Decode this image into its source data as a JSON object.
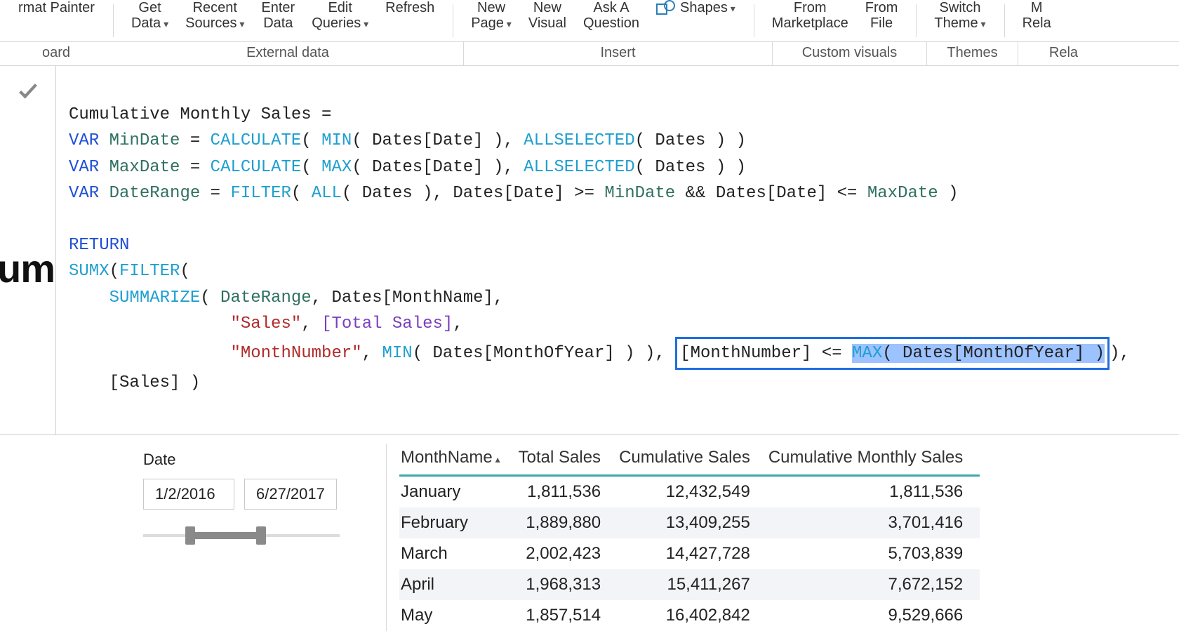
{
  "ribbon": {
    "format_painter_l1": "rmat Painter",
    "get_data_l1": "Get",
    "get_data_l2": "Data",
    "recent_l1": "Recent",
    "recent_l2": "Sources",
    "enter_l1": "Enter",
    "enter_l2": "Data",
    "edit_l1": "Edit",
    "edit_l2": "Queries",
    "refresh": "Refresh",
    "newpage_l1": "New",
    "newpage_l2": "Page",
    "newvis_l1": "New",
    "newvis_l2": "Visual",
    "ask_l1": "Ask A",
    "ask_l2": "Question",
    "shapes": "Shapes",
    "market_l1": "From",
    "market_l2": "Marketplace",
    "file_l1": "From",
    "file_l2": "File",
    "theme_l1": "Switch",
    "theme_l2": "Theme",
    "rel_l1": "M",
    "rel_l2": "Rela",
    "grp_clipboard": "oard",
    "grp_external": "External data",
    "grp_insert": "Insert",
    "grp_custom": "Custom visuals",
    "grp_themes": "Themes",
    "grp_rel": "Rela"
  },
  "leftFragment": "um",
  "formula": {
    "l1_a": "Cumulative Monthly Sales = ",
    "l2_var": "VAR",
    "l2_name": "MinDate",
    "l2_eq": " = ",
    "l2_calc": "CALCULATE",
    "l2_p1": "( ",
    "l2_min": "MIN",
    "l2_p2": "( Dates[Date] ), ",
    "l2_all": "ALLSELECTED",
    "l2_p3": "( Dates ) )",
    "l3_var": "VAR",
    "l3_name": "MaxDate",
    "l3_eq": " = ",
    "l3_calc": "CALCULATE",
    "l3_p1": "( ",
    "l3_max": "MAX",
    "l3_p2": "( Dates[Date] ), ",
    "l3_all": "ALLSELECTED",
    "l3_p3": "( Dates ) )",
    "l4_var": "VAR",
    "l4_name": "DateRange",
    "l4_eq": " = ",
    "l4_filter": "FILTER",
    "l4_p1": "( ",
    "l4_all": "ALL",
    "l4_p2": "( Dates ), Dates[Date] >= ",
    "l4_min": "MinDate",
    "l4_mid": " && Dates[Date] <= ",
    "l4_max": "MaxDate",
    "l4_p3": " )",
    "l5_return": "RETURN",
    "l6_sumx": "SUMX",
    "l6_p1": "(",
    "l6_filter": "FILTER",
    "l6_p2": "(",
    "l7_pad": "    ",
    "l7_sum": "SUMMARIZE",
    "l7_p1": "( ",
    "l7_dr": "DateRange",
    "l7_p2": ", Dates[MonthName],",
    "l8_pad": "                ",
    "l8_s": "\"Sales\"",
    "l8_c": ", ",
    "l8_ts": "[Total Sales]",
    "l8_e": ",",
    "l9_pad": "                ",
    "l9_s": "\"MonthNumber\"",
    "l9_c": ", ",
    "l9_min": "MIN",
    "l9_m": "( Dates[MonthOfYear] ) ), ",
    "l9_box_a": "[MonthNumber] <= ",
    "l9_box_fn": "MAX",
    "l9_box_b": "( Dates[MonthOfYear] )",
    "l9_tail": "),",
    "l10_pad": "    ",
    "l10": "[Sales] )"
  },
  "slicer": {
    "title": "Date",
    "from": "1/2/2016",
    "to": "6/27/2017",
    "range_left_pct": 24,
    "range_right_pct": 60
  },
  "table": {
    "headers": [
      "MonthName",
      "Total Sales",
      "Cumulative Sales",
      "Cumulative Monthly Sales"
    ],
    "rows": [
      {
        "m": "January",
        "ts": "1,811,536",
        "cs": "12,432,549",
        "cms": "1,811,536"
      },
      {
        "m": "February",
        "ts": "1,889,880",
        "cs": "13,409,255",
        "cms": "3,701,416"
      },
      {
        "m": "March",
        "ts": "2,002,423",
        "cs": "14,427,728",
        "cms": "5,703,839"
      },
      {
        "m": "April",
        "ts": "1,968,313",
        "cs": "15,411,267",
        "cms": "7,672,152"
      },
      {
        "m": "May",
        "ts": "1,857,514",
        "cs": "16,402,842",
        "cms": "9,529,666"
      }
    ]
  }
}
